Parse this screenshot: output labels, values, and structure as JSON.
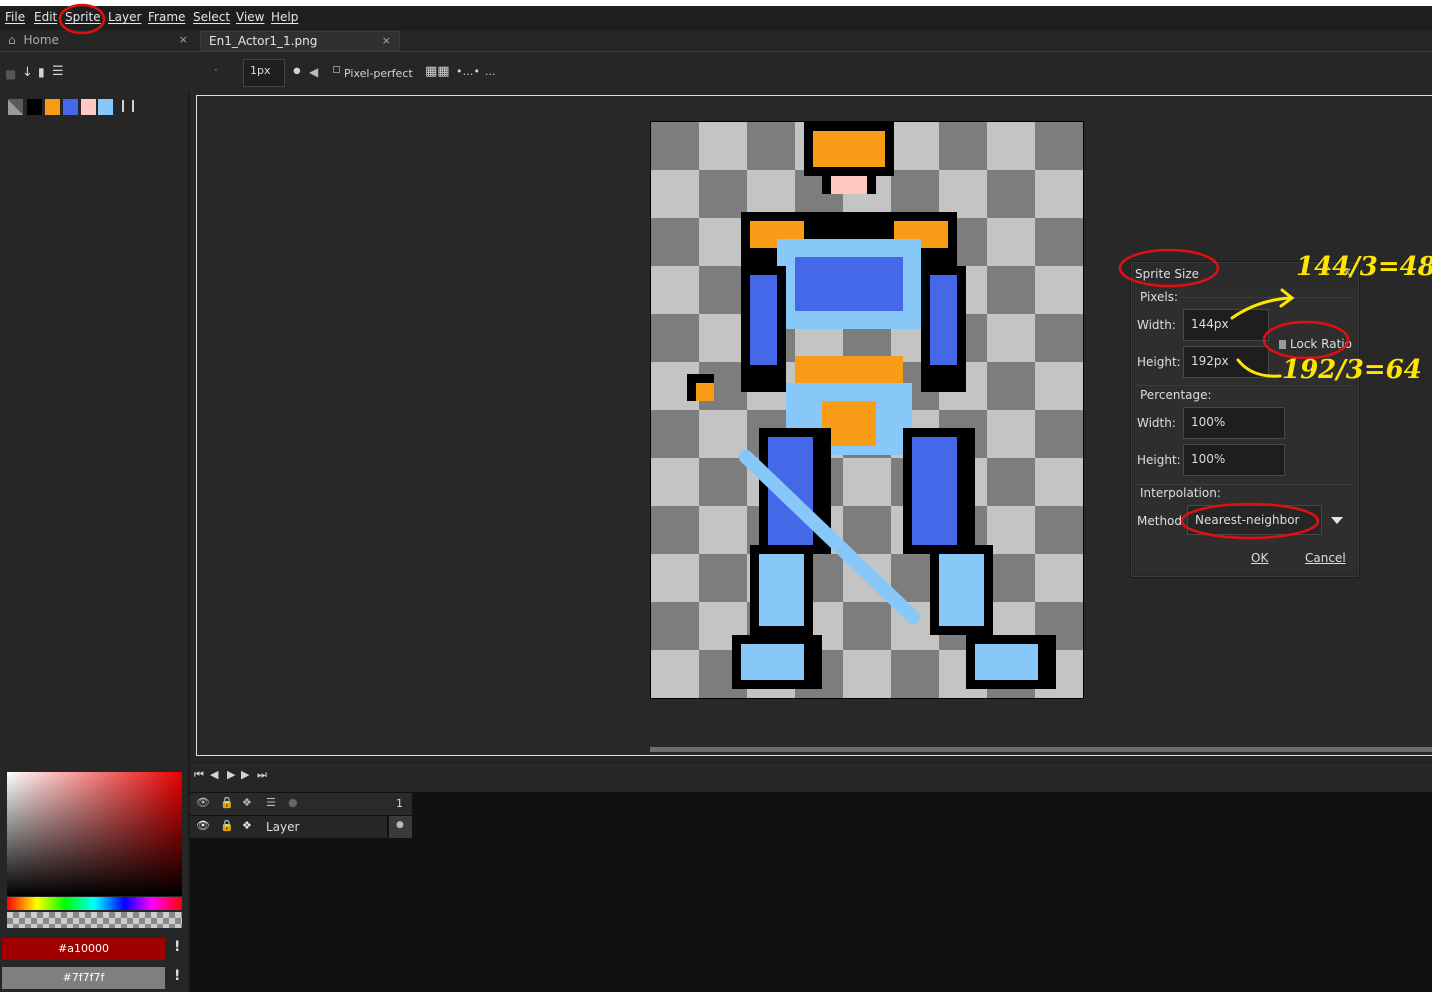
{
  "menu": [
    "File",
    "Edit",
    "Sprite",
    "Layer",
    "Frame",
    "Select",
    "View",
    "Help"
  ],
  "tabs": [
    {
      "label": "Home",
      "close": "×"
    },
    {
      "label": "En1_Actor1_1.png",
      "close": "×"
    }
  ],
  "toolbar": {
    "brush_size": "1px",
    "pixel_perfect_label": "Pixel-perfect",
    "more": "..."
  },
  "palette": [
    "#808080",
    "#000000",
    "#f89c18",
    "#4468e8",
    "#ffc8c0",
    "#88c8f8"
  ],
  "dialog": {
    "title": "Sprite Size",
    "close": "×",
    "help": "?",
    "pixels_label": "Pixels:",
    "width_label": "Width:",
    "width_value": "144px",
    "height_label": "Height:",
    "height_value": "192px",
    "lock_ratio_label": "Lock Ratio",
    "percentage_label": "Percentage:",
    "pct_width_label": "Width:",
    "pct_width_value": "100%",
    "pct_height_label": "Height:",
    "pct_height_value": "100%",
    "interpolation_label": "Interpolation:",
    "method_label": "Method",
    "method_value": "Nearest-neighbor",
    "ok_label": "OK",
    "cancel_label": "Cancel"
  },
  "annotations": {
    "width_calc": "144/3=48",
    "height_calc": "192/3=64"
  },
  "timeline": {
    "frame_number": "1",
    "layer_name": "Layer"
  },
  "colors": {
    "foreground": "#a10000",
    "background": "#7f7f7f"
  }
}
